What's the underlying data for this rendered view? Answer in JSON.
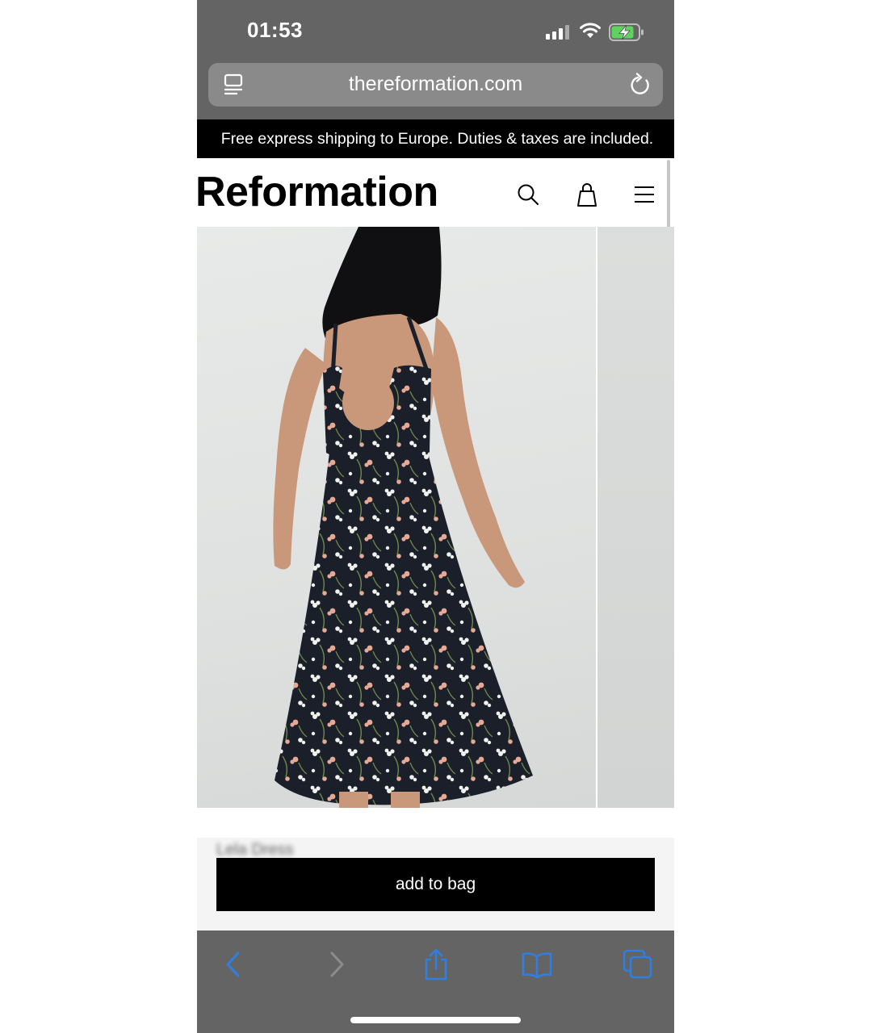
{
  "status": {
    "time": "01:53"
  },
  "browser": {
    "url": "thereformation.com"
  },
  "promo": {
    "text": "Free express shipping to Europe. Duties & taxes are included."
  },
  "header": {
    "logo": "Reformation",
    "icons": [
      "search-icon",
      "shopping-bag-icon",
      "menu-icon"
    ]
  },
  "product": {
    "name": "Lela Dress",
    "add_to_bag_label": "add to bag"
  },
  "toolbar": {
    "icons": [
      "back-icon",
      "forward-icon",
      "share-icon",
      "bookmarks-icon",
      "tabs-icon"
    ]
  },
  "colors": {
    "browser_chrome": "#646464",
    "promo_bg": "#000000",
    "button_bg": "#000000",
    "toolbar_accent": "#2f7fe0",
    "dress": "#1b1f2a"
  }
}
